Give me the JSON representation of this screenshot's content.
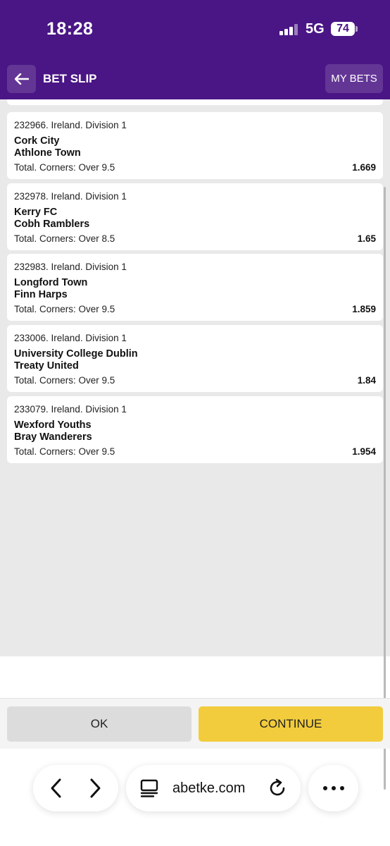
{
  "status": {
    "time": "18:28",
    "network": "5G",
    "battery": "74"
  },
  "header": {
    "title": "BET SLIP",
    "my_bets": "MY BETS"
  },
  "bets": [
    {
      "event": "232966. Ireland. Division 1",
      "team1": "Cork City",
      "team2": "Athlone Town",
      "market": "Total. Corners: Over 9.5",
      "odds": "1.669"
    },
    {
      "event": "232978. Ireland. Division 1",
      "team1": "Kerry FC",
      "team2": "Cobh Ramblers",
      "market": "Total. Corners: Over 8.5",
      "odds": "1.65"
    },
    {
      "event": "232983. Ireland. Division 1",
      "team1": "Longford Town",
      "team2": "Finn Harps",
      "market": "Total. Corners: Over 9.5",
      "odds": "1.859"
    },
    {
      "event": "233006. Ireland. Division 1",
      "team1": "University College Dublin",
      "team2": "Treaty United",
      "market": "Total. Corners: Over 9.5",
      "odds": "1.84"
    },
    {
      "event": "233079. Ireland. Division 1",
      "team1": "Wexford Youths",
      "team2": "Bray Wanderers",
      "market": "Total. Corners: Over 9.5",
      "odds": "1.954"
    }
  ],
  "actions": {
    "ok": "OK",
    "continue": "CONTINUE"
  },
  "browser": {
    "url": "abetke.com"
  }
}
